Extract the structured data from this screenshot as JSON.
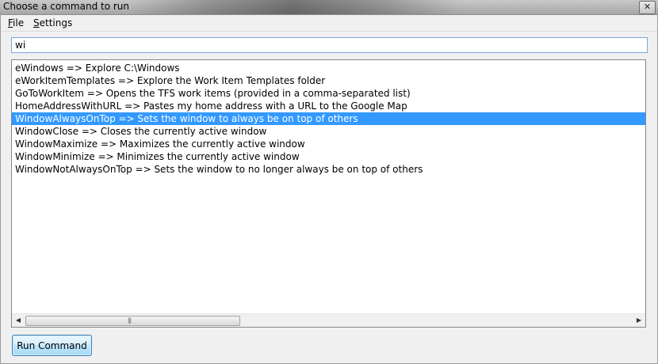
{
  "window": {
    "title": "Choose a command to run",
    "close_glyph": "✕"
  },
  "menu": {
    "items": [
      {
        "accel": "F",
        "rest": "ile"
      },
      {
        "accel": "S",
        "rest": "ettings"
      }
    ]
  },
  "search": {
    "value": "wi"
  },
  "commands": {
    "items": [
      "eWindows => Explore C:\\Windows",
      "eWorkItemTemplates => Explore the Work Item Templates folder",
      "GoToWorkItem => Opens the TFS work items (provided in a comma-separated list)",
      "HomeAddressWithURL => Pastes my home address with a URL to the Google Map",
      "WindowAlwaysOnTop => Sets the window to always be on top of others",
      "WindowClose => Closes the currently active window",
      "WindowMaximize => Maximizes the currently active window",
      "WindowMinimize => Minimizes the currently active window",
      "WindowNotAlwaysOnTop => Sets the window to no longer always be on top of others"
    ],
    "selected_index": 4
  },
  "scrollbar": {
    "left_glyph": "◀",
    "right_glyph": "▶",
    "grip_glyph": "|||"
  },
  "actions": {
    "run_label": "Run Command"
  },
  "colors": {
    "selection": "#3399ff",
    "input_focus_border": "#7aa7d8",
    "button_border": "#3c7fb1"
  },
  "icons": {
    "close": "close-icon",
    "scroll_left": "scroll-left-arrow-icon",
    "scroll_right": "scroll-right-arrow-icon"
  }
}
